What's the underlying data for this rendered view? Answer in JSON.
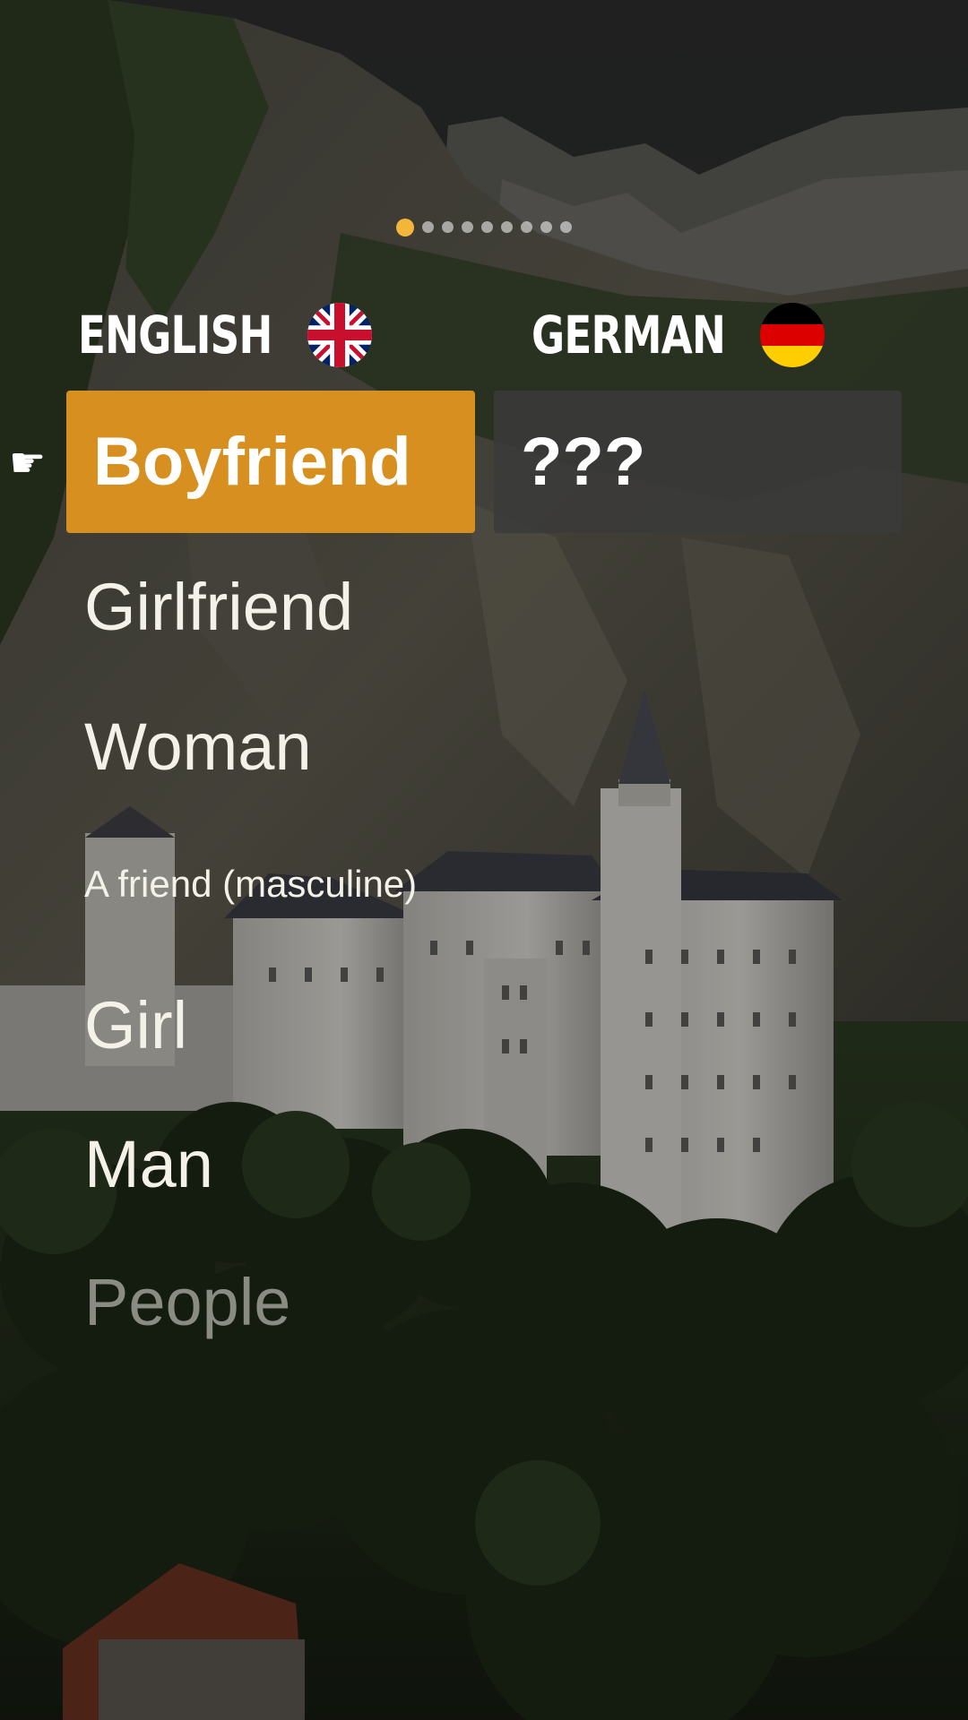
{
  "pagination": {
    "total": 9,
    "active_index": 0
  },
  "languages": {
    "source": {
      "name": "ENGLISH",
      "flag": "uk-flag-icon"
    },
    "target": {
      "name": "GERMAN",
      "flag": "germany-flag-icon"
    }
  },
  "current": {
    "pointer_icon": "pointing-hand-icon",
    "pointer_glyph": "☛",
    "source_word": "Boyfriend",
    "target_word": "???"
  },
  "word_list": [
    {
      "label": "Girlfriend"
    },
    {
      "label": "Woman"
    },
    {
      "label": "A friend (masculine)"
    },
    {
      "label": "Girl"
    },
    {
      "label": "Man"
    },
    {
      "label": "People"
    }
  ],
  "colors": {
    "accent": "#d7901f",
    "active_dot": "#f2b63a",
    "target_card": "#3a3a3a"
  }
}
